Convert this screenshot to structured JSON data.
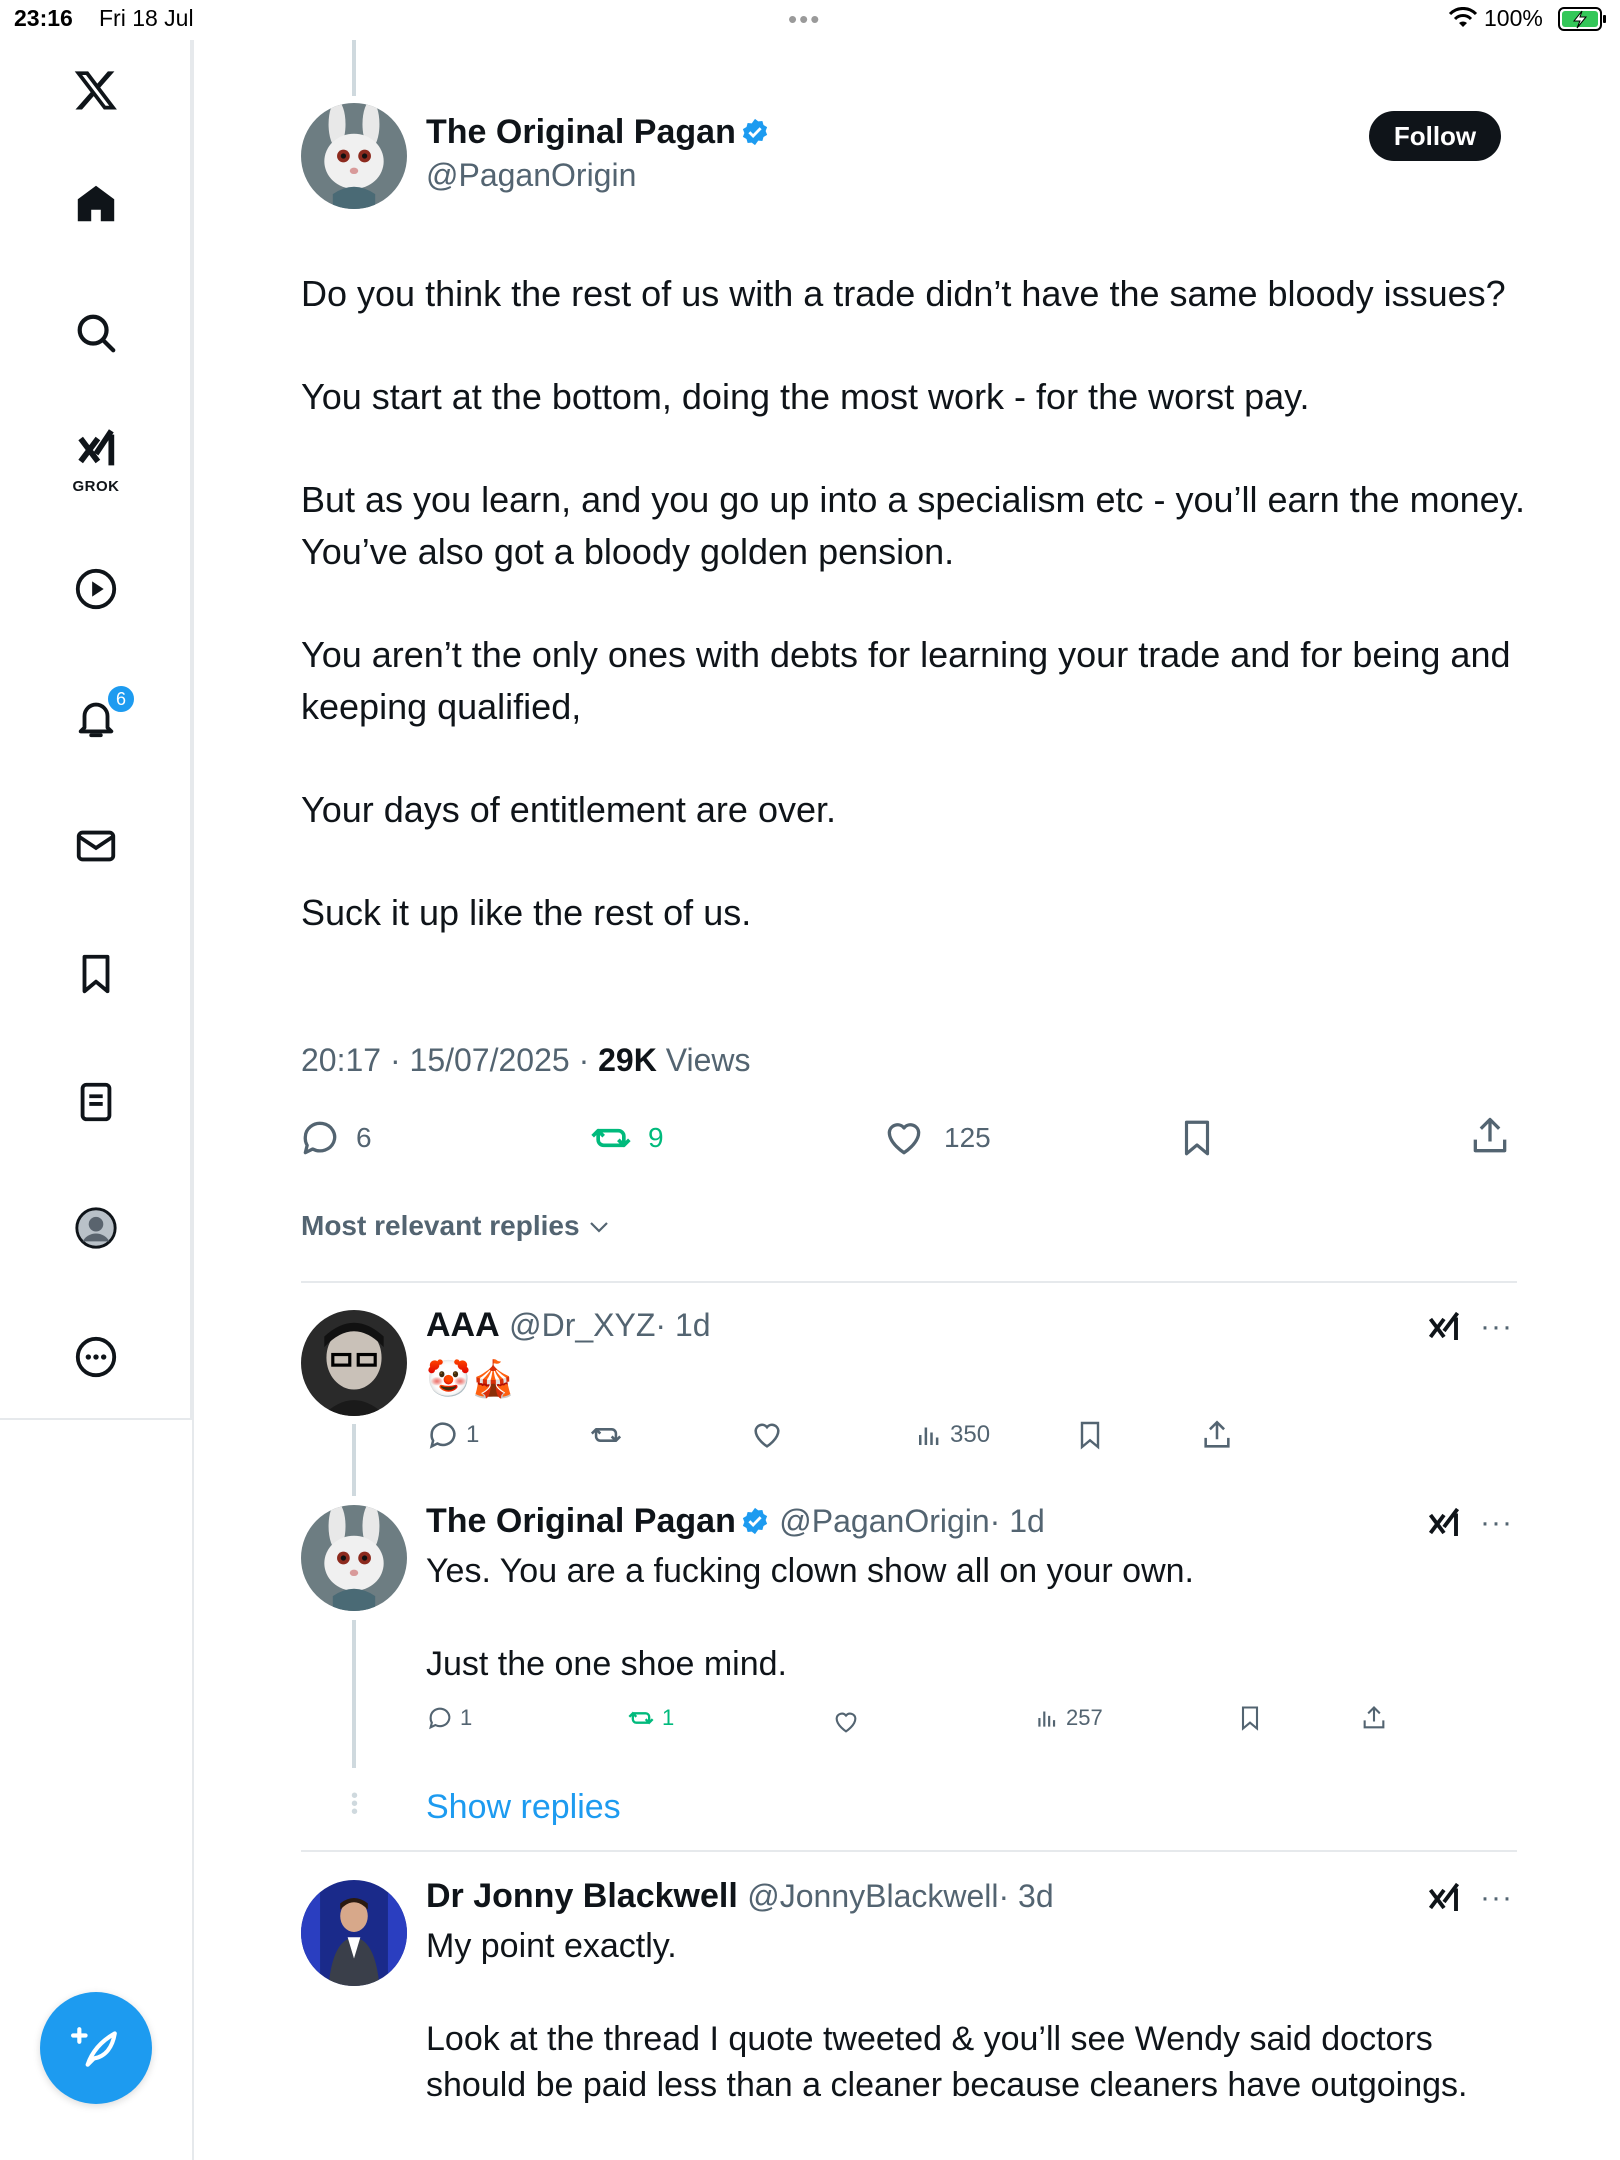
{
  "status_bar": {
    "time": "23:16",
    "date": "Fri 18 Jul",
    "battery": "100%"
  },
  "sidebar": {
    "grok_label": "GROK",
    "notification_count": "6"
  },
  "tweet": {
    "author_name": "The Original Pagan",
    "author_handle": "@PaganOrigin",
    "follow_label": "Follow",
    "paragraphs": [
      "Do you think the rest of us with a trade didn’t have the same bloody issues?",
      "You start at the bottom, doing the most work - for the worst pay.",
      "But as you learn, and you go up into a specialism etc - you’ll earn the money. You’ve also got a bloody golden pension.",
      "You aren’t the only ones with debts for learning your trade and for being and keeping qualified,",
      "Your days of entitlement are over.",
      "Suck it up like the rest of us."
    ],
    "timestamp": "20:17 · 15/07/2025 · ",
    "views_count": "29K",
    "views_label": " Views",
    "replies": "6",
    "reposts": "9",
    "likes": "125"
  },
  "replies_sort_label": "Most relevant replies",
  "replies": [
    {
      "name": "AAA",
      "handle": "@Dr_XYZ",
      "time": "· 1d",
      "text": "🤡🎪",
      "reply_count": "1",
      "views": "350"
    },
    {
      "name": "The Original Pagan",
      "handle": "@PaganOrigin",
      "time": "· 1d",
      "text_1": "Yes. You are a fucking clown show all on your own.",
      "text_2": "Just the one shoe mind.",
      "reply_count": "1",
      "repost_count": "1",
      "views": "257"
    },
    {
      "name": "Dr Jonny Blackwell",
      "handle": "@JonnyBlackwell",
      "time": "· 3d",
      "text_1": "My point exactly.",
      "text_2": "Look at the thread I quote tweeted & you’ll see Wendy said doctors should be paid less than a cleaner because cleaners have outgoings."
    }
  ],
  "show_replies_label": "Show replies",
  "colors": {
    "accent": "#1d9bf0",
    "repost_green": "#00ba7c",
    "muted": "#536471"
  }
}
